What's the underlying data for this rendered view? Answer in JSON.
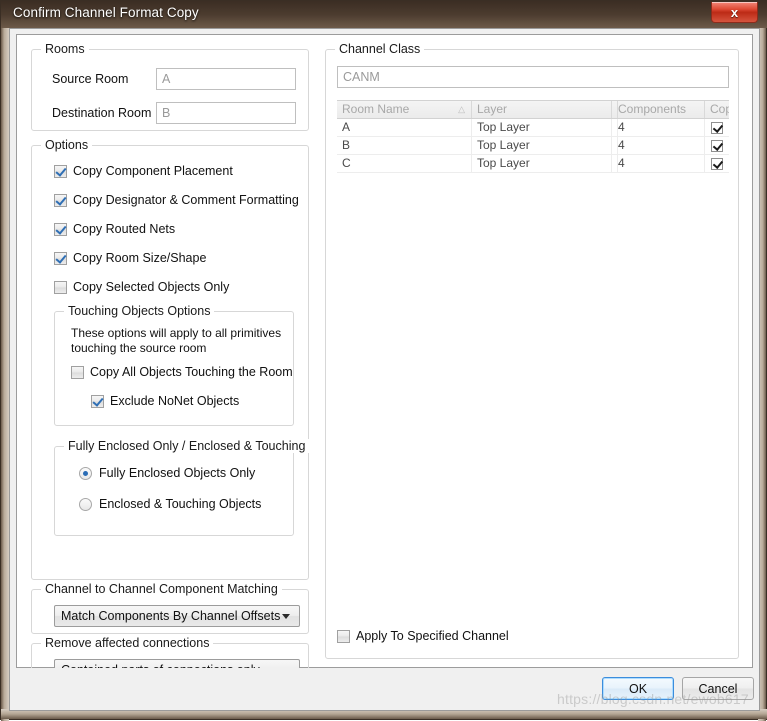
{
  "window": {
    "title": "Confirm Channel Format Copy",
    "close_icon": "close-icon",
    "close_label": "x"
  },
  "rooms": {
    "legend": "Rooms",
    "source_label": "Source Room",
    "source_value": "A",
    "destination_label": "Destination Room",
    "destination_value": "B"
  },
  "options": {
    "legend": "Options",
    "items": [
      {
        "label": "Copy Component Placement",
        "checked": true
      },
      {
        "label": "Copy Designator & Comment Formatting",
        "checked": true
      },
      {
        "label": "Copy Routed Nets",
        "checked": true
      },
      {
        "label": "Copy Room Size/Shape",
        "checked": true
      },
      {
        "label": "Copy Selected Objects Only",
        "checked": false
      }
    ]
  },
  "touching": {
    "legend": "Touching Objects Options",
    "note_line1": "These options will apply to all primitives",
    "note_line2": "touching the source room",
    "copy_all_label": "Copy All Objects Touching the Room",
    "copy_all_checked": false,
    "exclude_label": "Exclude NoNet Objects",
    "exclude_checked": true
  },
  "enclosed": {
    "legend": "Fully Enclosed Only / Enclosed & Touching",
    "options": [
      {
        "label": "Fully Enclosed Objects Only",
        "selected": true
      },
      {
        "label": "Enclosed & Touching Objects",
        "selected": false
      }
    ]
  },
  "matching": {
    "legend": "Channel to Channel Component Matching",
    "value": "Match Components By Channel Offsets"
  },
  "remove": {
    "legend": "Remove affected connections",
    "value": "Contained parts of connections only"
  },
  "channel_class": {
    "legend": "Channel Class",
    "input_value": "CANM",
    "columns": [
      "Room Name",
      "Layer",
      "",
      "Components",
      "Copy"
    ],
    "sort_indicator": "△",
    "rows": [
      {
        "room_name": "A",
        "layer": "Top Layer",
        "blank": "",
        "components": "4",
        "copy": true
      },
      {
        "room_name": "B",
        "layer": "Top Layer",
        "blank": "",
        "components": "4",
        "copy": true
      },
      {
        "room_name": "C",
        "layer": "Top Layer",
        "blank": "",
        "components": "4",
        "copy": true
      }
    ],
    "apply_label": "Apply To Specified Channel",
    "apply_checked": false
  },
  "footer": {
    "ok_label": "OK",
    "cancel_label": "Cancel"
  },
  "watermark": {
    "text": "https://blog.csdn.net/ewob617"
  }
}
